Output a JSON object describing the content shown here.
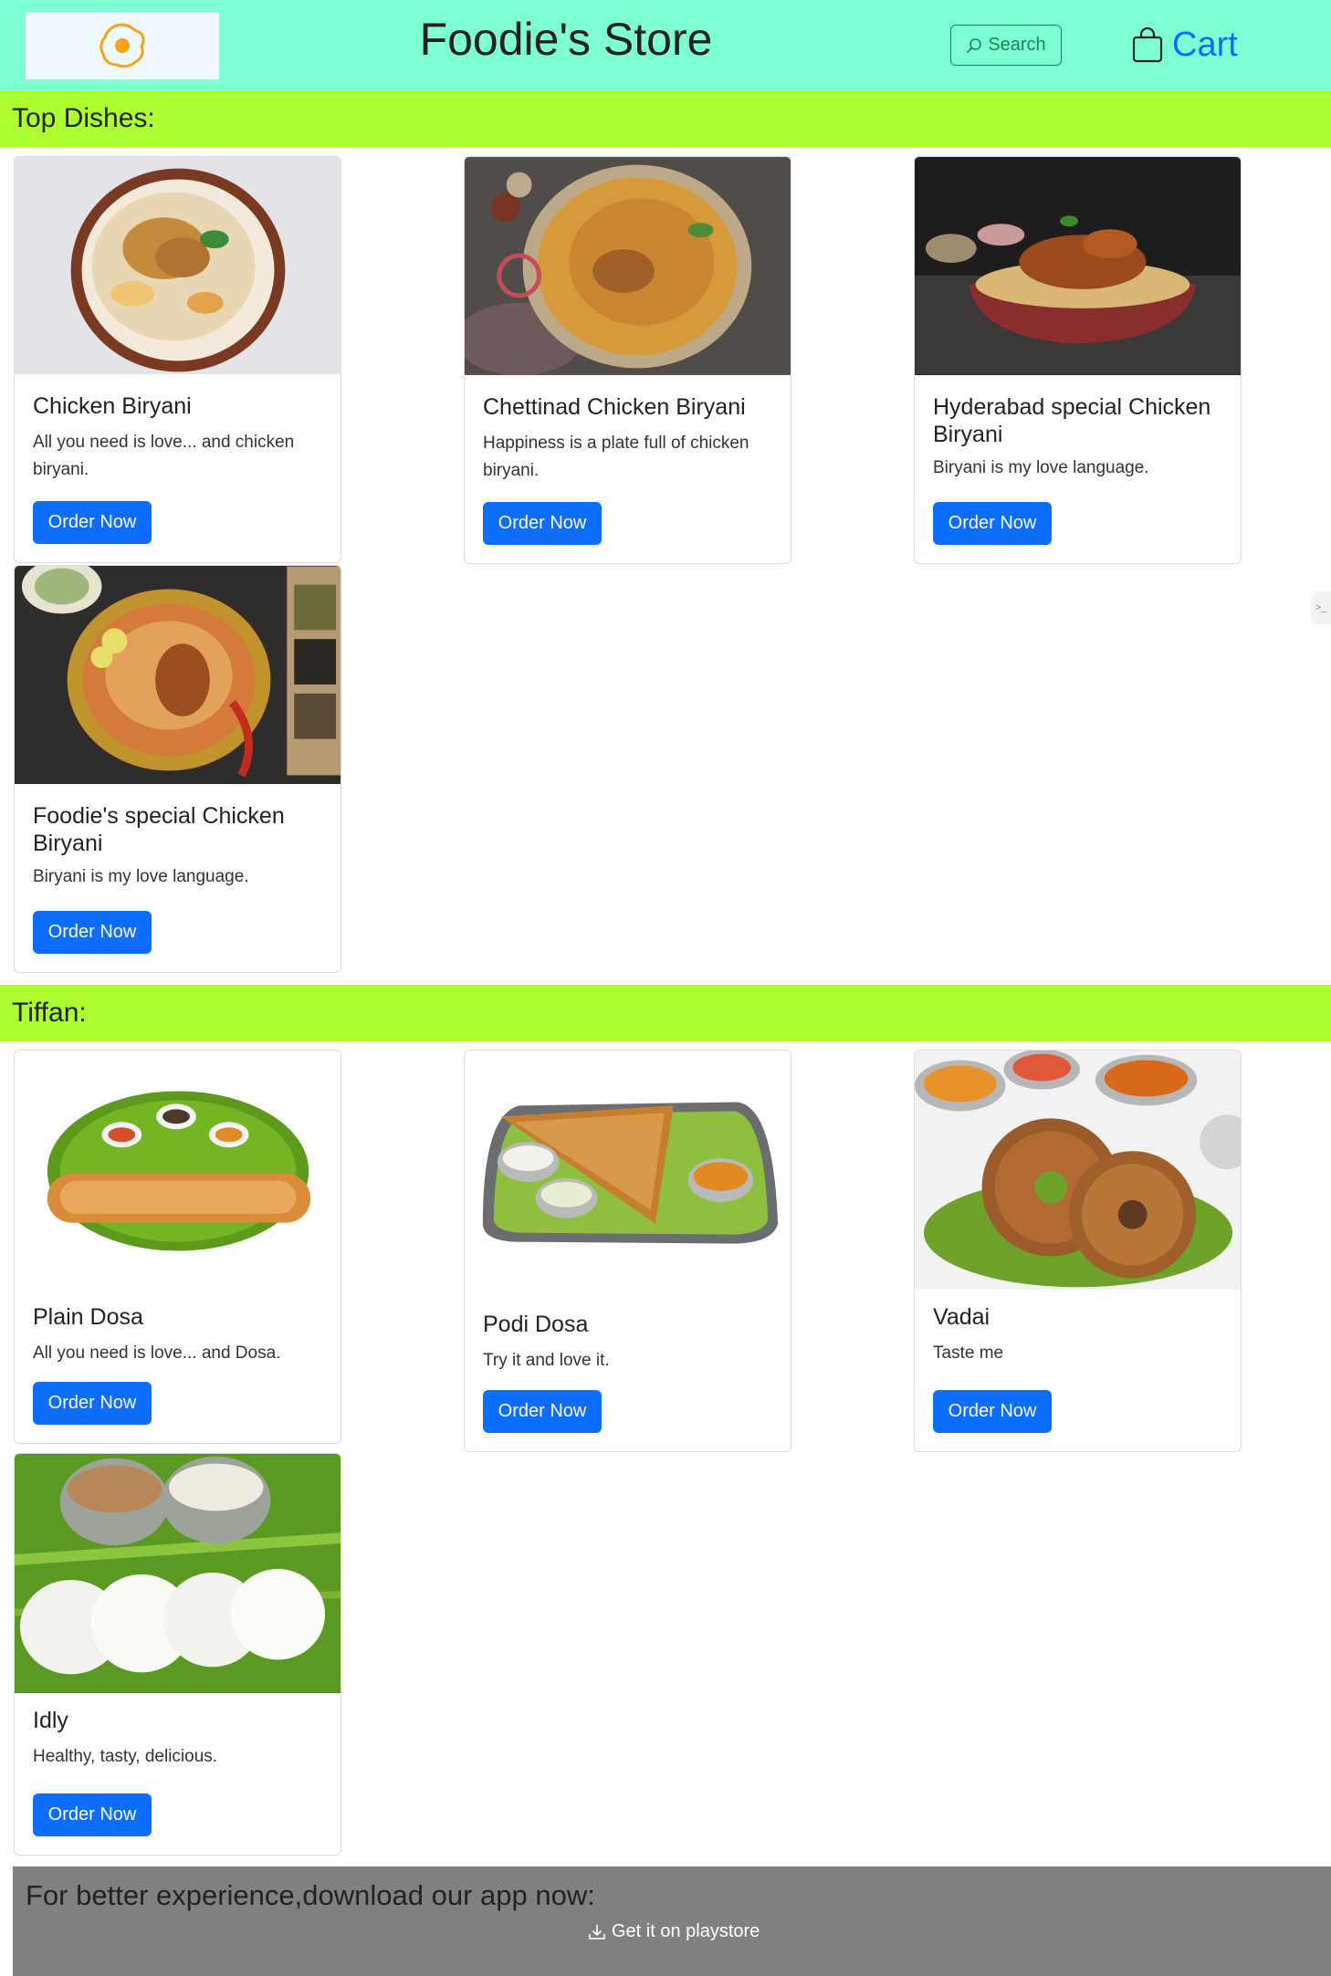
{
  "header": {
    "logo_icon": "fried-egg-icon",
    "title": "Foodie's Store",
    "search_label": "Search",
    "cart_label": "Cart"
  },
  "sections": [
    {
      "title": "Top Dishes:",
      "items": [
        {
          "name": "Chicken Biryani",
          "text": "All you need is love... and chicken biryani.",
          "button": "Order Now"
        },
        {
          "name": "Chettinad Chicken Biryani",
          "text": "Happiness is a plate full of chicken biryani.",
          "button": "Order Now"
        },
        {
          "name": "Hyderabad special Chicken Biryani",
          "text": "Biryani is my love language.",
          "button": "Order Now"
        },
        {
          "name": "Foodie's special Chicken Biryani",
          "text": "Biryani is my love language.",
          "button": "Order Now"
        }
      ]
    },
    {
      "title": "Tiffan:",
      "items": [
        {
          "name": "Plain Dosa",
          "text": "All you need is love... and Dosa.",
          "button": "Order Now"
        },
        {
          "name": "Podi Dosa",
          "text": "Try it and love it.",
          "button": "Order Now"
        },
        {
          "name": "Vadai",
          "text": "Taste me",
          "button": "Order Now"
        },
        {
          "name": "Idly",
          "text": "Healthy, tasty, delicious.",
          "button": "Order Now"
        }
      ]
    }
  ],
  "footer": {
    "text": "For better experience,download our app now:",
    "playstore_label": "Get it on playstore"
  },
  "colors": {
    "topbar": "#7fffd4",
    "section_bar": "#adff2f",
    "primary": "#0d6efd",
    "search_outline": "#198754",
    "footer": "#808080"
  }
}
